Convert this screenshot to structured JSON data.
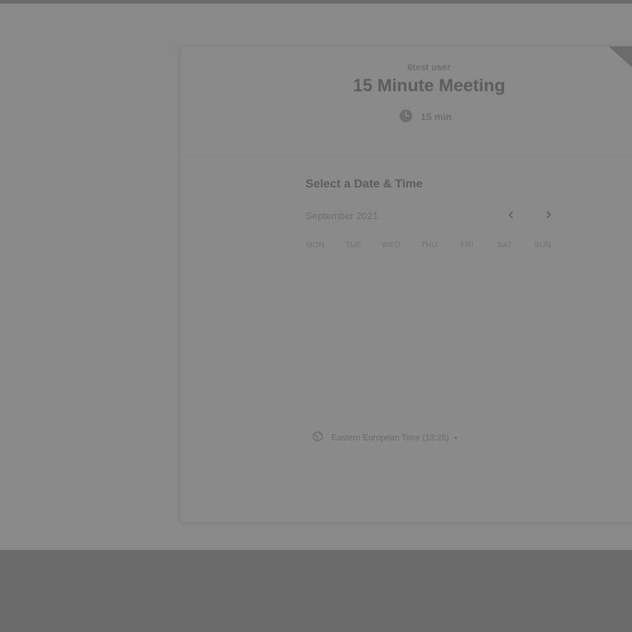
{
  "event": {
    "owner": "6test user",
    "title": "15 Minute Meeting",
    "duration": "15 min",
    "duration_icon": "clock-icon"
  },
  "picker": {
    "heading": "Select a Date & Time",
    "month": "September 2021",
    "prev_icon": "chevron-left-icon",
    "next_icon": "chevron-right-icon",
    "weekdays": [
      "MON",
      "TUE",
      "WED",
      "THU",
      "FRI",
      "SAT",
      "SUN"
    ]
  },
  "timezone": {
    "label": "Eastern European Time (13:26)",
    "icon": "globe-icon",
    "caret_icon": "caret-down-icon"
  },
  "colors": {
    "overlay_page": "#898989",
    "overlay_dark": "#6b6b6b",
    "title_text": "#5d5d5d"
  }
}
